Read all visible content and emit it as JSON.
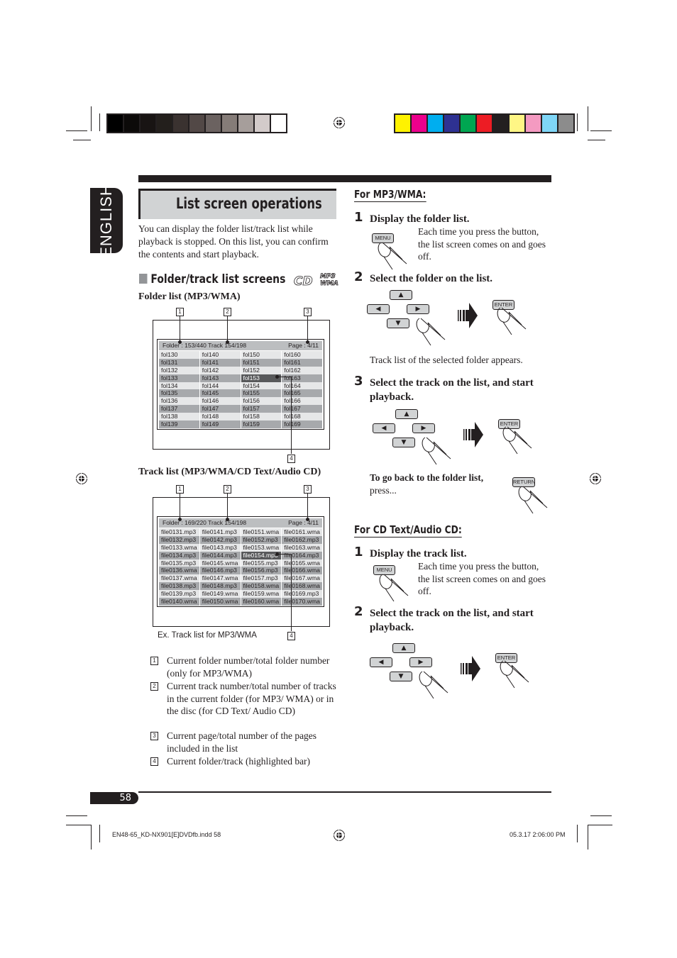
{
  "print_marks": {
    "grayscale_swatches": [
      "#000000",
      "#0c0a09",
      "#181413",
      "#231f1c",
      "#3a3230",
      "#524846",
      "#6b6260",
      "#857c78",
      "#a69e9b",
      "#d3cbca",
      "#ffffff"
    ],
    "color_swatches": [
      "#fff200",
      "#ec008c",
      "#00aeef",
      "#2e3192",
      "#00a651",
      "#ed1c24",
      "#231f20",
      "#fff685",
      "#f49ac1",
      "#7fd6f7",
      "#8c8c8c"
    ]
  },
  "language_tab": "ENGLISH",
  "title": "List screen operations",
  "intro": "You can display the folder list/track list while playback is stopped. On this list, you can confirm the contents and start playback.",
  "section": {
    "heading": "Folder/track list screens",
    "badges": [
      "CD",
      "MP3/WMA"
    ]
  },
  "folder_list": {
    "label": "Folder list (MP3/WMA)",
    "header_left": "Folder : 153/440  Track 154/198",
    "header_right": "Page : 4/11",
    "columns": [
      [
        "fol130",
        "fol131",
        "fol132",
        "fol133",
        "fol134",
        "fol135",
        "fol136",
        "fol137",
        "fol138",
        "fol139"
      ],
      [
        "fol140",
        "fol141",
        "fol142",
        "fol143",
        "fol144",
        "fol145",
        "fol146",
        "fol147",
        "fol148",
        "fol149"
      ],
      [
        "fol150",
        "fol151",
        "fol152",
        "fol153",
        "fol154",
        "fol155",
        "fol156",
        "fol157",
        "fol158",
        "fol159"
      ],
      [
        "fol160",
        "fol161",
        "fol162",
        "fol163",
        "fol164",
        "fol165",
        "fol166",
        "fol167",
        "fol168",
        "fol169"
      ]
    ],
    "highlighted": "fol153",
    "callouts": [
      "1",
      "2",
      "3",
      "4"
    ]
  },
  "track_list": {
    "label": "Track list (MP3/WMA/CD Text/Audio CD)",
    "header_left": "Folder : 169/220  Track 154/198",
    "header_right": "Page : 4/11",
    "columns": [
      [
        "file0131.mp3",
        "file0132.mp3",
        "file0133.wma",
        "file0134.mp3",
        "file0135.mp3",
        "file0136.wma",
        "file0137.wma",
        "file0138.mp3",
        "file0139.mp3",
        "file0140.wma"
      ],
      [
        "file0141.mp3",
        "file0142.mp3",
        "file0143.mp3",
        "file0144.mp3",
        "file0145.wma",
        "file0146.mp3",
        "file0147.wma",
        "file0148.mp3",
        "file0149.wma",
        "file0150.wma"
      ],
      [
        "file0151.wma",
        "file0152.mp3",
        "file0153.wma",
        "file0154.mp3",
        "file0155.mp3",
        "file0156.mp3",
        "file0157.mp3",
        "file0158.wma",
        "file0159.wma",
        "file0160.wma"
      ],
      [
        "file0161.wma",
        "file0162.mp3",
        "file0163.wma",
        "file0164.mp3",
        "file0165.wma",
        "file0166.wma",
        "file0167.wma",
        "file0168.wma",
        "file0169.mp3",
        "file0170.wma"
      ]
    ],
    "highlighted": "file0154.mp3",
    "caption": "Ex. Track list for MP3/WMA",
    "callouts": [
      "1",
      "2",
      "3",
      "4"
    ]
  },
  "legend": [
    {
      "num": "1",
      "text": "Current folder number/total folder number (only for MP3/WMA)"
    },
    {
      "num": "2",
      "text": "Current track number/total number of tracks in the current folder (for MP3/ WMA) or in the disc (for CD Text/ Audio CD)"
    },
    {
      "num": "3",
      "text": "Current page/total number of the pages included in the list"
    },
    {
      "num": "4",
      "text": "Current folder/track (highlighted bar)"
    }
  ],
  "mp3_section": {
    "heading": "For MP3/WMA:",
    "steps": [
      {
        "num": "1",
        "title": "Display the folder list.",
        "body": "Each time you press the button, the list screen comes on and goes off.",
        "button": "MENU"
      },
      {
        "num": "2",
        "title": "Select the folder on the list.",
        "note": "Track list of the selected folder appears.",
        "button": "ENTER"
      },
      {
        "num": "3",
        "title": "Select the track on the list, and start playback.",
        "button": "ENTER"
      }
    ],
    "return_note_bold": "To go back to the folder list,",
    "return_note": "press...",
    "return_button": "RETURN"
  },
  "cd_section": {
    "heading": "For CD Text/Audio CD:",
    "steps": [
      {
        "num": "1",
        "title": "Display the track list.",
        "body": "Each time you press the button, the list screen comes on and goes off.",
        "button": "MENU"
      },
      {
        "num": "2",
        "title": "Select the track on the list, and start playback.",
        "button": "ENTER"
      }
    ]
  },
  "arrows": {
    "up": "▲",
    "left": "◀",
    "right": "▶",
    "down": "▼"
  },
  "page_number": "58",
  "slug": {
    "file": "EN48-65_KD-NX901[E]DVDfb.indd   58",
    "timestamp": "05.3.17   2:06:00 PM"
  }
}
